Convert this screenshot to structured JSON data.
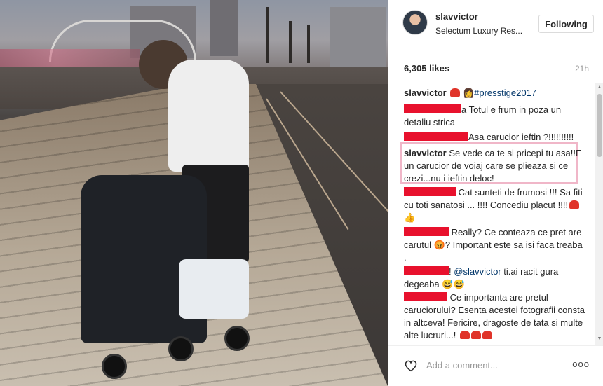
{
  "post": {
    "username": "slavvictor",
    "location": "Selectum Luxury Res...",
    "follow_label": "Following",
    "likes": "6,305 likes",
    "time": "21h"
  },
  "caption": {
    "username": "slavvictor",
    "hashtag": "#presstige2017"
  },
  "comments": [
    {
      "text": "a Totul e frum in poza un detaliu strica"
    },
    {
      "text": "Asa carucior ieftin ?!!!!!!!!!!"
    },
    {
      "username": "slavvictor",
      "text": "Se vede ca te si pricepi tu asa!!E un carucior de voiaj care se plieaza si ce crezi...nu i ieftin deloc!"
    },
    {
      "text": "Cat sunteti de frumosi !!! Sa fiti cu toti sanatosi ... !!!! Concediu placut !!!!"
    },
    {
      "text": "Really? Ce conteaza ce pret are carutul",
      "text2": "? Important este sa isi faca treaba ."
    },
    {
      "mention": "@slavvictor",
      "text": "ti.ai racit gura degeaba",
      "prefix": "!"
    },
    {
      "text": "Ce importanta are pretul caruciorului? Esenta acestei fotografii consta in altceva! Fericire, dragoste de tata si multe alte lucruri...!"
    }
  ],
  "footer": {
    "placeholder": "Add a comment...",
    "more": "ooo"
  },
  "icons": {
    "like": "heart-outline-icon",
    "more": "more-options-icon",
    "verified_heart": "red-heart-icon"
  },
  "colors": {
    "redaction": "#e8112d",
    "highlight_box": "#f0b6c8",
    "link": "#003569"
  }
}
